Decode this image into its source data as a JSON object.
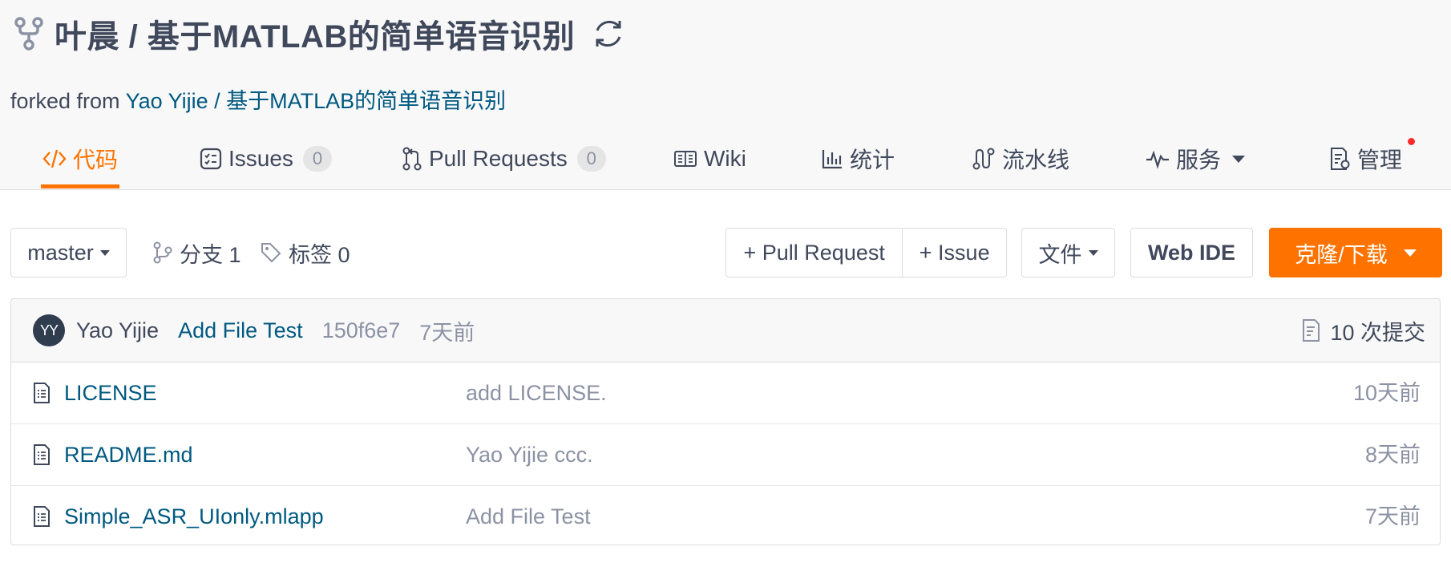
{
  "repo": {
    "title": "叶晨 / 基于MATLAB的简单语音识别",
    "forked_prefix": "forked from ",
    "forked_owner": "Yao Yijie",
    "forked_sep": " / ",
    "forked_repo": "基于MATLAB的简单语音识别"
  },
  "tabs": [
    {
      "label": "代码",
      "icon": "code-icon",
      "active": true
    },
    {
      "label": "Issues",
      "count": "0",
      "icon": "issues-icon"
    },
    {
      "label": "Pull Requests",
      "count": "0",
      "icon": "pull-request-icon"
    },
    {
      "label": "Wiki",
      "icon": "wiki-icon"
    },
    {
      "label": "统计",
      "icon": "stats-icon"
    },
    {
      "label": "流水线",
      "icon": "pipeline-icon"
    },
    {
      "label": "服务",
      "icon": "service-icon",
      "dropdown": true
    },
    {
      "label": "管理",
      "icon": "manage-icon",
      "notification": true
    }
  ],
  "toolbar": {
    "branch": "master",
    "branches": "分支 1",
    "tags": "标签 0",
    "pull_request": "+ Pull Request",
    "issue": "+ Issue",
    "file": "文件",
    "web_ide": "Web IDE",
    "clone": "克隆/下载"
  },
  "commit": {
    "avatar": "YY",
    "author": "Yao Yijie",
    "message": "Add File Test",
    "sha": "150f6e7",
    "time": "7天前",
    "count": "10 次提交"
  },
  "files": [
    {
      "name": "LICENSE",
      "message": "add LICENSE.",
      "time": "10天前"
    },
    {
      "name": "README.md",
      "message": "Yao Yijie ccc.",
      "time": "8天前"
    },
    {
      "name": "Simple_ASR_UIonly.mlapp",
      "message": "Add File Test",
      "time": "7天前"
    }
  ],
  "colors": {
    "accent": "#fe7300",
    "link": "#005980",
    "text": "#40485b",
    "muted": "#8c92a4"
  }
}
